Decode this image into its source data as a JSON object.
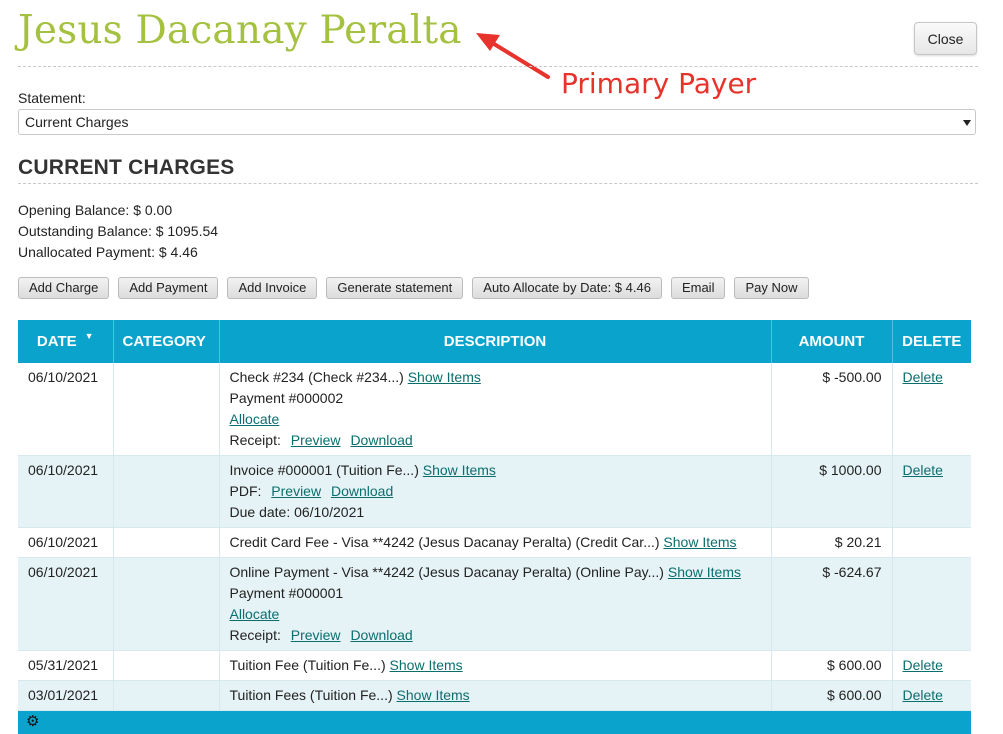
{
  "header": {
    "payer_name": "Jesus Dacanay Peralta",
    "close_label": "Close",
    "annotation": "Primary Payer",
    "annotation_color": "#e8322c",
    "title_color": "#a4c13f"
  },
  "statement": {
    "label": "Statement:",
    "selected": "Current Charges"
  },
  "section": {
    "title": "CURRENT CHARGES",
    "opening_balance": "Opening Balance: $ 0.00",
    "outstanding_balance": "Outstanding Balance: $ 1095.54",
    "unallocated_payment": "Unallocated Payment: $ 4.46"
  },
  "actions": {
    "add_charge": "Add Charge",
    "add_payment": "Add Payment",
    "add_invoice": "Add Invoice",
    "generate_statement": "Generate statement",
    "auto_allocate": "Auto Allocate by Date: $ 4.46",
    "email": "Email",
    "pay_now": "Pay Now"
  },
  "table": {
    "header_color": "#0aa3cc",
    "columns": {
      "date": "DATE",
      "category": "CATEGORY",
      "description": "DESCRIPTION",
      "amount": "AMOUNT",
      "delete": "DELETE"
    },
    "rows": [
      {
        "date": "06/10/2021",
        "category": "",
        "desc_main": "Check #234  (Check #234...)",
        "show_items": "Show Items",
        "payment": "Payment #000002",
        "allocate": "Allocate",
        "receipt_label": "Receipt:",
        "preview": "Preview",
        "download": "Download",
        "amount": "$ -500.00",
        "delete": "Delete"
      },
      {
        "date": "06/10/2021",
        "category": "",
        "desc_main": "Invoice #000001  (Tuition Fe...)",
        "show_items": "Show Items",
        "pdf_label": "PDF:",
        "preview": "Preview",
        "download": "Download",
        "due_date": "Due date: 06/10/2021",
        "amount": "$ 1000.00",
        "delete": "Delete"
      },
      {
        "date": "06/10/2021",
        "category": "",
        "desc_main": "Credit Card Fee - Visa **4242 (Jesus Dacanay Peralta)  (Credit Car...)",
        "show_items": "Show Items",
        "amount": "$ 20.21"
      },
      {
        "date": "06/10/2021",
        "category": "",
        "desc_main": "Online Payment - Visa **4242 (Jesus Dacanay Peralta)  (Online Pay...)",
        "show_items": "Show Items",
        "payment": "Payment #000001",
        "allocate": "Allocate",
        "receipt_label": "Receipt:",
        "preview": "Preview",
        "download": "Download",
        "amount": "$ -624.67"
      },
      {
        "date": "05/31/2021",
        "category": "",
        "desc_main": "Tuition Fee  (Tuition Fe...)",
        "show_items": "Show Items",
        "amount": "$ 600.00",
        "delete": "Delete"
      },
      {
        "date": "03/01/2021",
        "category": "",
        "desc_main": "Tuition Fees  (Tuition Fe...)",
        "show_items": "Show Items",
        "amount": "$ 600.00",
        "delete": "Delete"
      }
    ]
  },
  "footer": {
    "icon": "gear-icon"
  }
}
